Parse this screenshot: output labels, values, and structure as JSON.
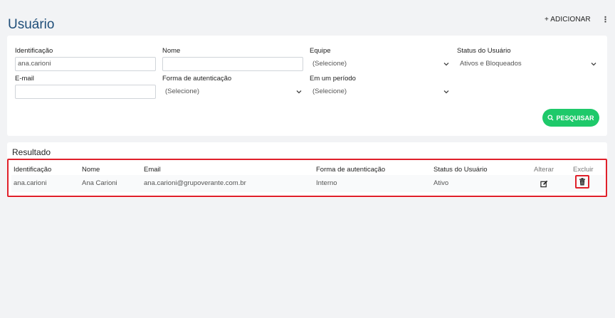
{
  "header": {
    "title": "Usuário",
    "add_label": "+ ADICIONAR",
    "more_label": "⋮"
  },
  "filters": {
    "identificacao": {
      "label": "Identificação",
      "value": "ana.carioni"
    },
    "nome": {
      "label": "Nome",
      "value": ""
    },
    "equipe": {
      "label": "Equipe",
      "value": "(Selecione)"
    },
    "status": {
      "label": "Status do Usuário",
      "value": "Ativos e Bloqueados"
    },
    "email": {
      "label": "E-mail",
      "value": ""
    },
    "forma": {
      "label": "Forma de autenticação",
      "value": "(Selecione)"
    },
    "periodo": {
      "label": "Em um período",
      "value": "(Selecione)"
    },
    "search_label": "PESQUISAR"
  },
  "results": {
    "title": "Resultado",
    "columns": [
      "Identificação",
      "Nome",
      "Email",
      "Forma de autenticação",
      "Status do Usuário",
      "Alterar",
      "Excluir"
    ],
    "rows": [
      [
        "ana.carioni",
        "Ana Carioni",
        "ana.carioni@grupoverante.com.br",
        "Interno",
        "Ativo"
      ]
    ]
  },
  "colors": {
    "accent": "#1f4e79",
    "search_button": "#1ec96a",
    "highlight": "#e0202a"
  },
  "icons": {
    "edit": "edit-icon",
    "delete": "trash-icon",
    "search": "search-icon",
    "select": "chevron-down-icon"
  }
}
